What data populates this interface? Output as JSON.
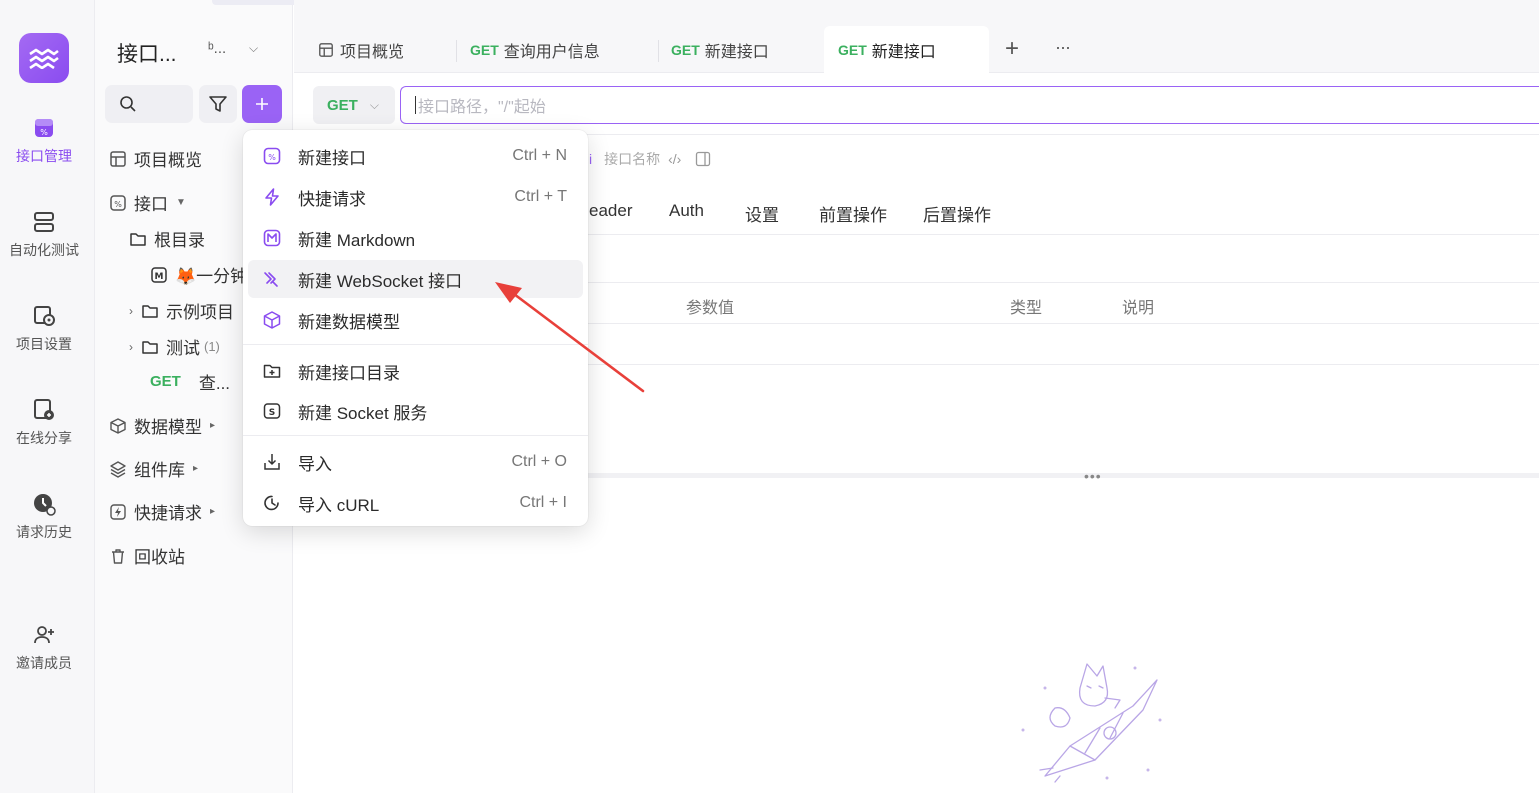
{
  "rail": {
    "items": [
      {
        "label": "接口管理",
        "icon": "api-icon"
      },
      {
        "label": "自动化测试",
        "icon": "automation-icon"
      },
      {
        "label": "项目设置",
        "icon": "settings-icon"
      },
      {
        "label": "在线分享",
        "icon": "share-icon"
      },
      {
        "label": "请求历史",
        "icon": "history-icon"
      },
      {
        "label": "邀请成员",
        "icon": "invite-user-icon"
      }
    ]
  },
  "sidebar": {
    "project_title": "接口...",
    "branch": "ᵇ...",
    "tree": {
      "overview": "项目概览",
      "apis": "接口",
      "root": "根目录",
      "doc_item": "🦊一分钟",
      "example_folder": "示例项目",
      "test_folder": "测试",
      "test_count": "(1)",
      "get_method": "GET",
      "get_item": "查...",
      "data_models": "数据模型",
      "components": "组件库",
      "quick_requests": "快捷请求",
      "trash": "回收站"
    }
  },
  "tabs": [
    {
      "method": "",
      "label": "项目概览"
    },
    {
      "method": "GET",
      "label": "查询用户信息"
    },
    {
      "method": "GET",
      "label": "新建接口"
    },
    {
      "method": "GET",
      "label": "新建接口"
    }
  ],
  "tab_actions": {
    "add": "+",
    "more": "···"
  },
  "request": {
    "method": "GET",
    "url_placeholder": "接口路径，\"/\"起始",
    "name_placeholder": "接口名称"
  },
  "subtabs": [
    "eader",
    "Auth",
    "设置",
    "前置操作",
    "后置操作"
  ],
  "params_table": {
    "headers": [
      "参数值",
      "类型",
      "说明"
    ]
  },
  "menu": {
    "items": [
      {
        "label": "新建接口",
        "shortcut": "Ctrl + N"
      },
      {
        "label": "快捷请求",
        "shortcut": "Ctrl + T"
      },
      {
        "label": "新建 Markdown",
        "shortcut": ""
      },
      {
        "label": "新建 WebSocket 接口",
        "shortcut": ""
      },
      {
        "label": "新建数据模型",
        "shortcut": ""
      },
      {
        "label": "新建接口目录",
        "shortcut": ""
      },
      {
        "label": "新建 Socket 服务",
        "shortcut": ""
      },
      {
        "label": "导入",
        "shortcut": "Ctrl + O"
      },
      {
        "label": "导入 cURL",
        "shortcut": "Ctrl + I"
      }
    ]
  },
  "colors": {
    "accent": "#9a63f5",
    "get": "#3bb05f",
    "annotation_arrow": "#e8403a"
  }
}
